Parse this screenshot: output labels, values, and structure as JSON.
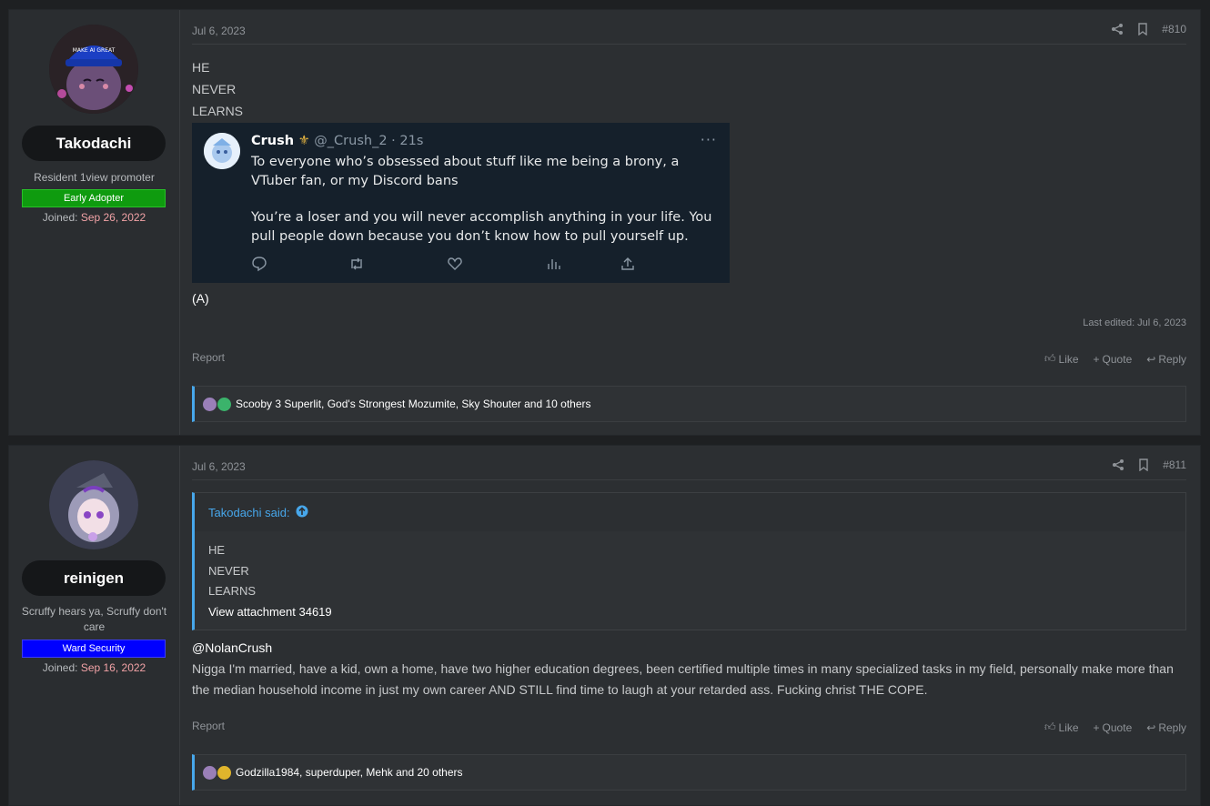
{
  "posts": [
    {
      "user": {
        "name": "Takodachi",
        "title": "Resident 1view promoter",
        "banner": "Early Adopter",
        "banner_color": "#0f9b0f",
        "joined_label": "Joined:",
        "joined_date": "Sep 26, 2022"
      },
      "date": "Jul 6, 2023",
      "number": "#810",
      "lines": [
        "HE",
        "NEVER",
        "LEARNS"
      ],
      "tweet": {
        "name": "Crush",
        "handle": "@_Crush_2 · 21s",
        "more": "···",
        "text1": "To everyone who’s obsessed about stuff like me being a brony, a VTuber fan, or my Discord bans",
        "text2": "You’re a loser and you will never accomplish anything in your life. You pull people down because you don’t know how to pull yourself up."
      },
      "after_text": "(A)",
      "last_edited": "Last edited: Jul 6, 2023",
      "report": "Report",
      "like": "Like",
      "quote": "Quote",
      "reply": "Reply",
      "reactions": "Scooby 3 Superlit, God's Strongest Mozumite, Sky Shouter and 10 others"
    },
    {
      "user": {
        "name": "reinigen",
        "title": "Scruffy hears ya, Scruffy don't care",
        "banner": "Ward Security",
        "banner_color": "#0000ff",
        "joined_label": "Joined:",
        "joined_date": "Sep 16, 2022"
      },
      "date": "Jul 6, 2023",
      "number": "#811",
      "quote": {
        "author": "Takodachi said:",
        "lines": [
          "HE",
          "NEVER",
          "LEARNS"
        ],
        "attachment": "View attachment 34619"
      },
      "mention": "@NolanCrush",
      "text": "Nigga I'm married, have a kid, own a home, have two higher education degrees, been certified multiple times in many specialized tasks in my field, personally make more than the median household income in just my own career AND STILL find time to laugh at your retarded ass. Fucking christ THE COPE.",
      "report": "Report",
      "like": "Like",
      "quote_label": "Quote",
      "reply": "Reply",
      "reactions": "Godzilla1984, superduper, Mehk and 20 others"
    }
  ],
  "icons": {
    "share": "share-icon",
    "bookmark": "bookmark-icon",
    "like": "thumbs-up-icon",
    "quote": "plus-icon",
    "reply": "reply-arrow-icon",
    "tweet_reply": "comment-icon",
    "tweet_retweet": "retweet-icon",
    "tweet_like": "heart-icon",
    "tweet_views": "bar-chart-icon",
    "tweet_share": "upload-icon",
    "quote_goto": "arrow-up-circle-icon"
  },
  "colors": {
    "accent": "#47a7eb",
    "joined_date": "#f1a2a6",
    "tweet_bg": "#15202b"
  }
}
